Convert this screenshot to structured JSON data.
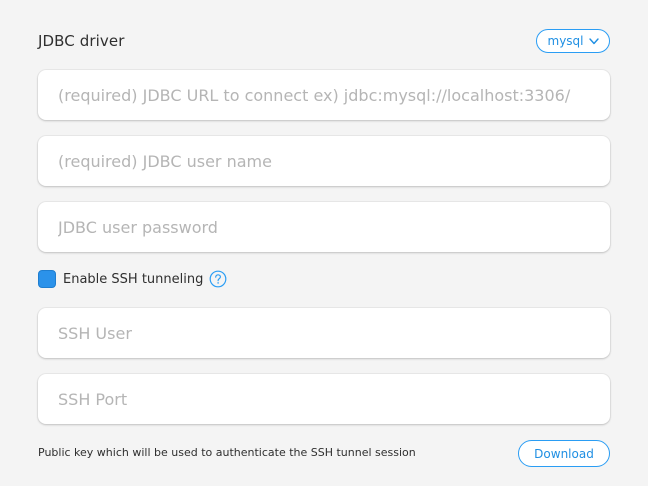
{
  "header": {
    "title": "JDBC driver",
    "driver_value": "mysql"
  },
  "fields": {
    "jdbc_url_placeholder": "(required) JDBC URL to connect ex) jdbc:mysql://localhost:3306/",
    "jdbc_user_placeholder": "(required) JDBC user name",
    "jdbc_password_placeholder": "JDBC user password",
    "ssh_user_placeholder": "SSH User",
    "ssh_port_placeholder": "SSH Port"
  },
  "ssh": {
    "label": "Enable SSH tunneling",
    "enabled": true
  },
  "footer": {
    "text": "Public key which will be used to authenticate the SSH tunnel session",
    "download_label": "Download"
  },
  "colors": {
    "accent": "#2a9df4",
    "checkbox_fill": "#2b92ea",
    "placeholder": "#b5b5b5",
    "background": "#f4f4f4"
  },
  "icons": {
    "driver_chevron": "chevron-down-icon",
    "help": "question-circle-icon"
  }
}
